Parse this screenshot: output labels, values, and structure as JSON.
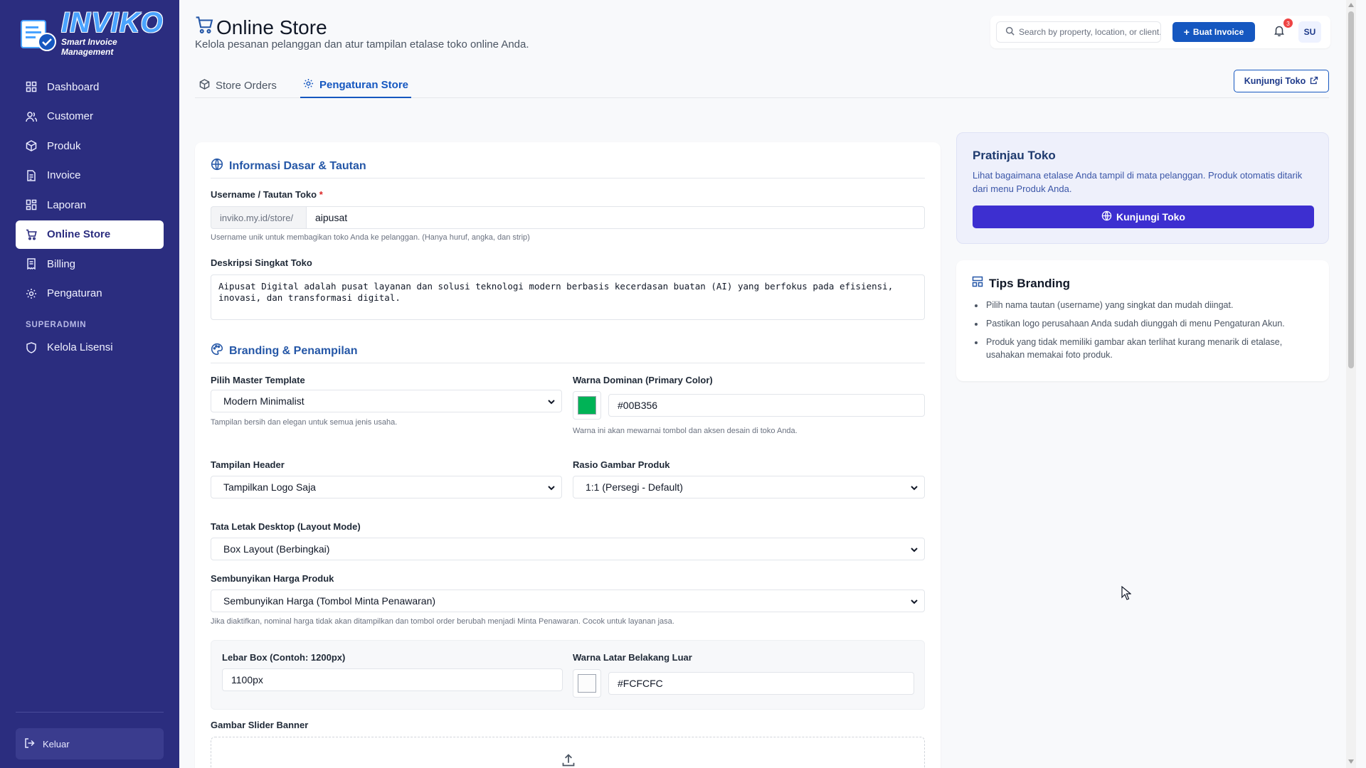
{
  "brand": {
    "title": "INVIKO",
    "subtitle": "Smart Invoice Management",
    "primary_color": "#2b2d7f"
  },
  "sidebar": {
    "items": [
      {
        "label": "Dashboard",
        "icon": "dashboard-icon"
      },
      {
        "label": "Customer",
        "icon": "users-icon"
      },
      {
        "label": "Produk",
        "icon": "box-icon"
      },
      {
        "label": "Invoice",
        "icon": "document-icon"
      },
      {
        "label": "Laporan",
        "icon": "grid-icon"
      },
      {
        "label": "Online Store",
        "icon": "cart-icon",
        "active": true
      },
      {
        "label": "Billing",
        "icon": "receipt-icon"
      },
      {
        "label": "Pengaturan",
        "icon": "gear-icon"
      }
    ],
    "section_label": "SUPERADMIN",
    "admin_items": [
      {
        "label": "Kelola Lisensi",
        "icon": "shield-icon"
      }
    ],
    "logout_label": "Keluar"
  },
  "header": {
    "title": "Online Store",
    "subtitle": "Kelola pesanan pelanggan dan atur tampilan etalase toko online Anda.",
    "search_placeholder": "Search by property, location, or client...",
    "create_invoice_label": "Buat Invoice",
    "notification_count": "3",
    "avatar_initials": "SU"
  },
  "tabs": [
    {
      "label": "Store Orders",
      "icon": "box-icon",
      "active": false
    },
    {
      "label": "Pengaturan Store",
      "icon": "gear-icon",
      "active": true
    }
  ],
  "visit_store_label": "Kunjungi Toko",
  "form": {
    "basic_section_title": "Informasi Dasar & Tautan",
    "username_label": "Username / Tautan Toko",
    "username_required": "*",
    "username_prefix": "inviko.my.id/store/",
    "username_value": "aipusat",
    "username_hint": "Username unik untuk membagikan toko Anda ke pelanggan. (Hanya huruf, angka, dan strip)",
    "description_label": "Deskripsi Singkat Toko",
    "description_value": "Aipusat Digital adalah pusat layanan dan solusi teknologi modern berbasis kecerdasan buatan (AI) yang berfokus pada efisiensi, inovasi, dan transformasi digital.",
    "branding_section_title": "Branding & Penampilan",
    "template_label": "Pilih Master Template",
    "template_value": "Modern Minimalist",
    "template_hint": "Tampilan bersih dan elegan untuk semua jenis usaha.",
    "primary_color_label": "Warna Dominan (Primary Color)",
    "primary_color_value": "#00B356",
    "primary_color_hint": "Warna ini akan mewarnai tombol dan aksen desain di toko Anda.",
    "header_label": "Tampilan Header",
    "header_value": "Tampilkan Logo Saja",
    "ratio_label": "Rasio Gambar Produk",
    "ratio_value": "1:1 (Persegi - Default)",
    "layout_label": "Tata Letak Desktop (Layout Mode)",
    "layout_value": "Box Layout (Berbingkai)",
    "hide_price_label": "Sembunyikan Harga Produk",
    "hide_price_value": "Sembunyikan Harga (Tombol Minta Penawaran)",
    "hide_price_hint": "Jika diaktifkan, nominal harga tidak akan ditampilkan dan tombol order berubah menjadi Minta Penawaran. Cocok untuk layanan jasa.",
    "box_width_label": "Lebar Box (Contoh: 1200px)",
    "box_width_value": "1100px",
    "outer_bg_label": "Warna Latar Belakang Luar",
    "outer_bg_value": "#FCFCFC",
    "slider_label": "Gambar Slider Banner"
  },
  "preview": {
    "title": "Pratinjau Toko",
    "text": "Lihat bagaimana etalase Anda tampil di mata pelanggan. Produk otomatis ditarik dari menu Produk Anda.",
    "button_label": "Kunjungi Toko"
  },
  "tips": {
    "title": "Tips Branding",
    "items": [
      "Pilih nama tautan (username) yang singkat dan mudah diingat.",
      "Pastikan logo perusahaan Anda sudah diunggah di menu Pengaturan Akun.",
      "Produk yang tidak memiliki gambar akan terlihat kurang menarik di etalase, usahakan memakai foto produk."
    ]
  }
}
